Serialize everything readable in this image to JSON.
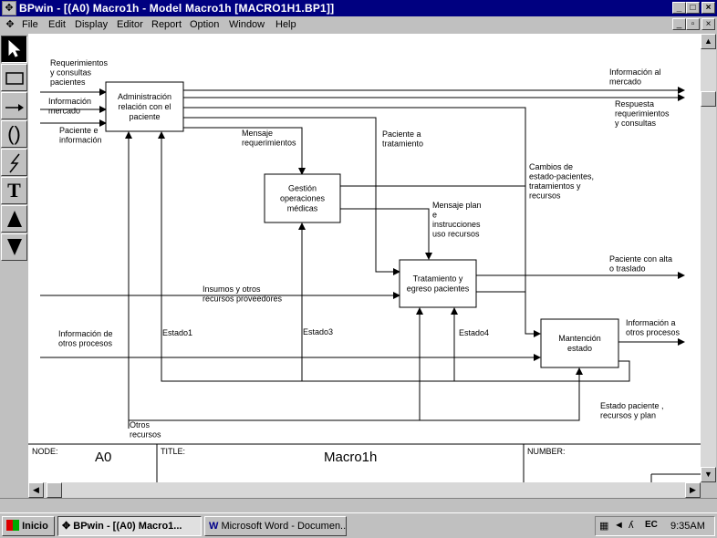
{
  "window": {
    "title": "BPwin - [(A0) Macro1h  - Model Macro1h  [MACRO1H1.BP1]]"
  },
  "menu": [
    "File",
    "Edit",
    "Display",
    "Editor",
    "Report",
    "Option",
    "Window",
    "Help"
  ],
  "toolbox": {
    "tools": [
      "pointer-tool",
      "box-tool",
      "arrow-tool",
      "tunnel-tool",
      "squiggle-tool",
      "text-tool",
      "go-to-parent-tool",
      "go-to-child-tool"
    ]
  },
  "diagram": {
    "boxes": [
      {
        "lines": [
          "Administración",
          "relación con el",
          "paciente"
        ]
      },
      {
        "lines": [
          "Gestión",
          "operaciones",
          "médicas"
        ]
      },
      {
        "lines": [
          "Tratamiento y",
          "egreso pacientes"
        ]
      },
      {
        "lines": [
          "Mantención",
          "estado"
        ]
      }
    ],
    "labels": [
      [
        "Requerimientos",
        "y consultas",
        "pacientes"
      ],
      [
        "Información",
        "mercado"
      ],
      [
        "Paciente e",
        "información"
      ],
      [
        "Mensaje",
        "requerimientos"
      ],
      [
        "Paciente a",
        "tratamiento"
      ],
      [
        "Información al",
        "mercado"
      ],
      [
        "Respuesta",
        "requerimientos",
        "y consultas"
      ],
      [
        "Cambios de",
        "estado-pacientes,",
        "tratamientos y",
        "recursos"
      ],
      [
        "Mensaje plan",
        "e",
        "instrucciones",
        "uso recursos"
      ],
      [
        "Paciente con alta",
        "o traslado"
      ],
      [
        "Insumos y otros",
        "recursos proveedores"
      ],
      [
        "Información de",
        "otros procesos"
      ],
      [
        "Estado1"
      ],
      [
        "Estado3"
      ],
      [
        "Estado4"
      ],
      [
        "Información a",
        "otros procesos"
      ],
      [
        "Estado paciente ,",
        "recursos  y plan"
      ],
      [
        "Otros",
        "recursos"
      ]
    ]
  },
  "footer": {
    "node_label": "NODE:",
    "node_value": "A0",
    "title_label": "TITLE:",
    "title_value": "Macro1h",
    "number_label": "NUMBER:"
  },
  "taskbar": {
    "start": "Inicio",
    "tasks": [
      "BPwin - [(A0) Macro1...",
      "Microsoft Word - Documen..."
    ],
    "clock": "9:35AM"
  }
}
